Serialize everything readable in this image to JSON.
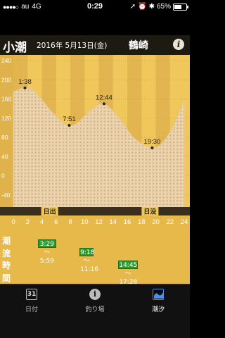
{
  "status": {
    "carrier": "au",
    "network": "4G",
    "time": "0:29",
    "battery": "65%",
    "battery_level": 0.65
  },
  "header": {
    "tide_type": "小潮",
    "date": "2016年 5月13日(金)",
    "location": "鶴崎",
    "info_glyph": "i"
  },
  "chart_data": {
    "type": "area",
    "x": [
      0,
      1.63,
      3,
      5,
      7,
      7.85,
      9,
      11,
      12.73,
      15,
      17,
      19.5,
      21,
      22.5,
      24
    ],
    "y": [
      175,
      183,
      175,
      140,
      110,
      105,
      110,
      138,
      150,
      118,
      78,
      58,
      70,
      105,
      158
    ],
    "xlim": [
      0,
      24
    ],
    "ylim": [
      -80,
      240
    ],
    "x_ticks": [
      "0",
      "2",
      "4",
      "6",
      "8",
      "10",
      "12",
      "14",
      "16",
      "18",
      "20",
      "22",
      "24"
    ],
    "y_ticks": [
      "240",
      "200",
      "160",
      "120",
      "80",
      "40",
      "0",
      "-40",
      "-80"
    ],
    "annotations": [
      {
        "label": "1:38",
        "x": 1.63,
        "y": 183
      },
      {
        "label": "7:51",
        "x": 7.85,
        "y": 105
      },
      {
        "label": "12:44",
        "x": 12.73,
        "y": 150
      },
      {
        "label": "19:30",
        "x": 19.5,
        "y": 58
      }
    ],
    "sunrise_label": "日出",
    "sunset_label": "日没",
    "sunrise_hour": 5.1,
    "sunset_hour": 19.2,
    "colors": {
      "fill": "#f3d898",
      "band_dark": "#e2b551",
      "band_light": "#f0c75a",
      "axis_text": "#ffffff"
    }
  },
  "flow": {
    "title": "潮流時間",
    "periods": [
      {
        "label": "3:29～5:59",
        "start": 3.48,
        "end": 5.98
      },
      {
        "label": "9:18～11:16",
        "start": 9.3,
        "end": 11.27
      },
      {
        "label": "14:45～17:28",
        "start": 14.75,
        "end": 17.47
      }
    ]
  },
  "tabs": [
    {
      "label": "日付",
      "icon": "calendar-icon",
      "icon_text": "31"
    },
    {
      "label": "釣り場",
      "icon": "info-icon",
      "icon_text": "i"
    },
    {
      "label": "潮汐",
      "icon": "tide-chart-icon",
      "active": true
    }
  ]
}
